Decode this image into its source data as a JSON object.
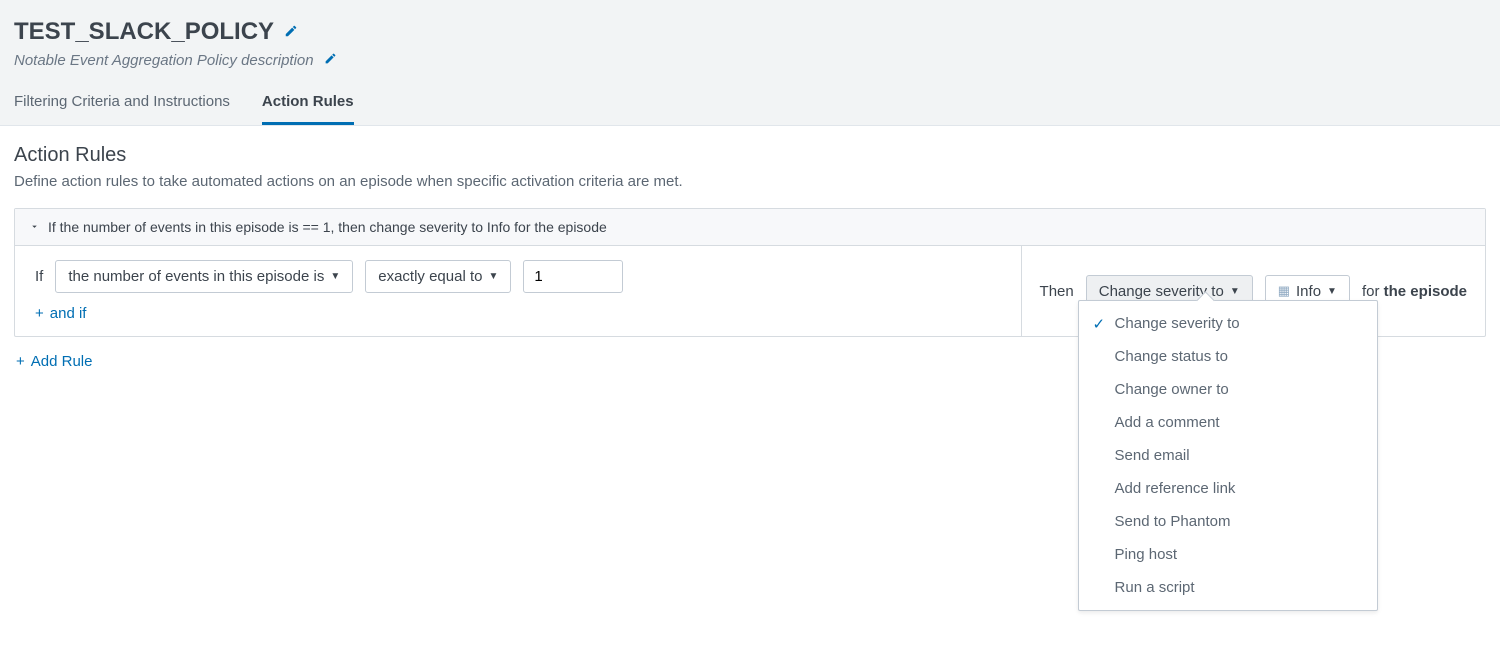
{
  "header": {
    "title": "TEST_SLACK_POLICY",
    "description": "Notable Event Aggregation Policy description"
  },
  "tabs": [
    {
      "label": "Filtering Criteria and Instructions",
      "active": false
    },
    {
      "label": "Action Rules",
      "active": true
    }
  ],
  "section": {
    "title": "Action Rules",
    "description": "Define action rules to take automated actions on an episode when specific activation criteria are met."
  },
  "rule": {
    "summary": "If the number of events in this episode is == 1, then change severity to Info for the episode",
    "if_label": "If",
    "condition_field": "the number of events in this episode is",
    "operator": "exactly equal to",
    "value": "1",
    "and_if": "and if",
    "then_label": "Then",
    "action_selected": "Change severity to",
    "severity_value": "Info",
    "for_prefix": "for",
    "for_bold": "the episode"
  },
  "action_menu": {
    "items": [
      {
        "label": "Change severity to",
        "selected": true
      },
      {
        "label": "Change status to",
        "selected": false
      },
      {
        "label": "Change owner to",
        "selected": false
      },
      {
        "label": "Add a comment",
        "selected": false
      },
      {
        "label": "Send email",
        "selected": false
      },
      {
        "label": "Add reference link",
        "selected": false
      },
      {
        "label": "Send to Phantom",
        "selected": false
      },
      {
        "label": "Ping host",
        "selected": false
      },
      {
        "label": "Run a script",
        "selected": false
      }
    ]
  },
  "add_rule_label": "Add Rule"
}
